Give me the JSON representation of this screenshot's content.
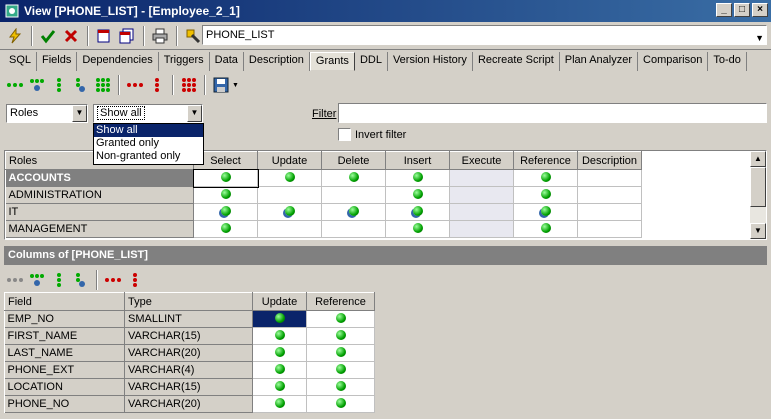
{
  "window": {
    "title": "View [PHONE_LIST] - [Employee_2_1]",
    "min": "_",
    "max": "□",
    "close": "×"
  },
  "object_name": "PHONE_LIST",
  "tabs": [
    "SQL",
    "Fields",
    "Dependencies",
    "Triggers",
    "Data",
    "Description",
    "Grants",
    "DDL",
    "Version History",
    "Recreate Script",
    "Plan Analyzer",
    "Comparison",
    "To-do"
  ],
  "active_tab": "Grants",
  "grants": {
    "roles_combo": "Roles",
    "show_combo": "Show all",
    "show_options": [
      "Show all",
      "Granted only",
      "Non-granted only"
    ],
    "filter_label": "Filter",
    "filter_value": "",
    "invert_label": "Invert filter",
    "columns": [
      "Roles",
      "Select",
      "Update",
      "Delete",
      "Insert",
      "Execute",
      "Reference",
      "Description"
    ],
    "rows": [
      {
        "name": "ACCOUNTS",
        "select": "granted",
        "update": "granted",
        "delete": "granted",
        "insert": "granted",
        "execute": "",
        "reference": "granted"
      },
      {
        "name": "ADMINISTRATION",
        "select": "granted",
        "update": "",
        "delete": "",
        "insert": "granted",
        "execute": "",
        "reference": "granted"
      },
      {
        "name": "IT",
        "select": "granted-grant",
        "update": "granted-grant",
        "delete": "granted-grant",
        "insert": "granted-grant",
        "execute": "",
        "reference": "granted-grant"
      },
      {
        "name": "MANAGEMENT",
        "select": "granted",
        "update": "",
        "delete": "",
        "insert": "granted",
        "execute": "",
        "reference": "granted"
      }
    ]
  },
  "columns_panel": {
    "title": "Columns of [PHONE_LIST]",
    "headers": [
      "Field",
      "Type",
      "Update",
      "Reference"
    ],
    "rows": [
      {
        "field": "EMP_NO",
        "type": "SMALLINT",
        "update": true,
        "reference": true
      },
      {
        "field": "FIRST_NAME",
        "type": "VARCHAR(15)",
        "update": true,
        "reference": true
      },
      {
        "field": "LAST_NAME",
        "type": "VARCHAR(20)",
        "update": true,
        "reference": true
      },
      {
        "field": "PHONE_EXT",
        "type": "VARCHAR(4)",
        "update": true,
        "reference": true
      },
      {
        "field": "LOCATION",
        "type": "VARCHAR(15)",
        "update": true,
        "reference": true
      },
      {
        "field": "PHONE_NO",
        "type": "VARCHAR(20)",
        "update": true,
        "reference": true
      }
    ]
  },
  "colors": {
    "title_start": "#0a246a",
    "title_end": "#3a6ea5",
    "granted": "#00a000",
    "panel_header": "#808080"
  }
}
